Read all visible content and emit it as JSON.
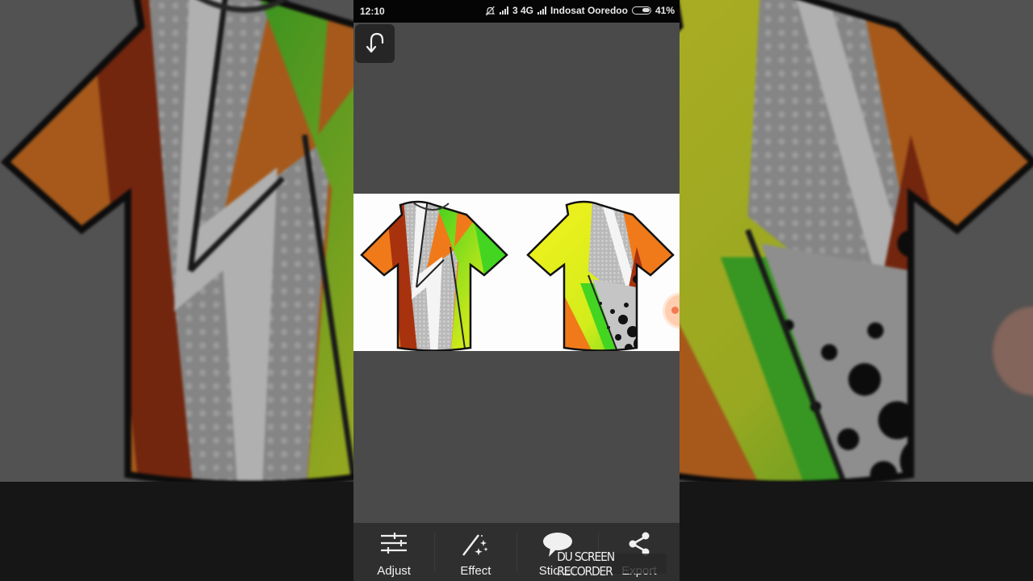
{
  "status_bar": {
    "time": "12:10",
    "network": "3 4G",
    "carrier": "Indosat Ooredoo",
    "battery_percent": "41%",
    "battery_level": 0.41,
    "icons": [
      "notifications-off-icon",
      "signal-icon",
      "signal-icon",
      "battery-icon"
    ]
  },
  "editor": {
    "undo_icon": "undo-icon",
    "canvas_images": [
      {
        "name": "jersey-front",
        "colors": [
          "#f07a1a",
          "#b5b5b5",
          "#3fd21f",
          "#f4ef1c",
          "#a8320e"
        ]
      },
      {
        "name": "jersey-back",
        "colors": [
          "#f4ef1c",
          "#b5b5b5",
          "#3fd21f",
          "#f07a1a",
          "#111111"
        ]
      }
    ]
  },
  "toolbar": {
    "items": [
      {
        "label": "Adjust",
        "icon": "sliders-icon"
      },
      {
        "label": "Effect",
        "icon": "magic-wand-icon"
      },
      {
        "label": "Sticker",
        "icon": "speech-bubble-icon"
      },
      {
        "label": "Export",
        "icon": "share-icon"
      }
    ]
  },
  "overlay": {
    "watermark": "DU SCREEN RECORDER"
  },
  "colors": {
    "status_bar_bg": "#050505",
    "editor_bg": "#4a4a4a",
    "toolbar_bg": "#2f2f2f",
    "canvas_bg": "#fdfdfd",
    "floating_button": "#f27a55"
  }
}
